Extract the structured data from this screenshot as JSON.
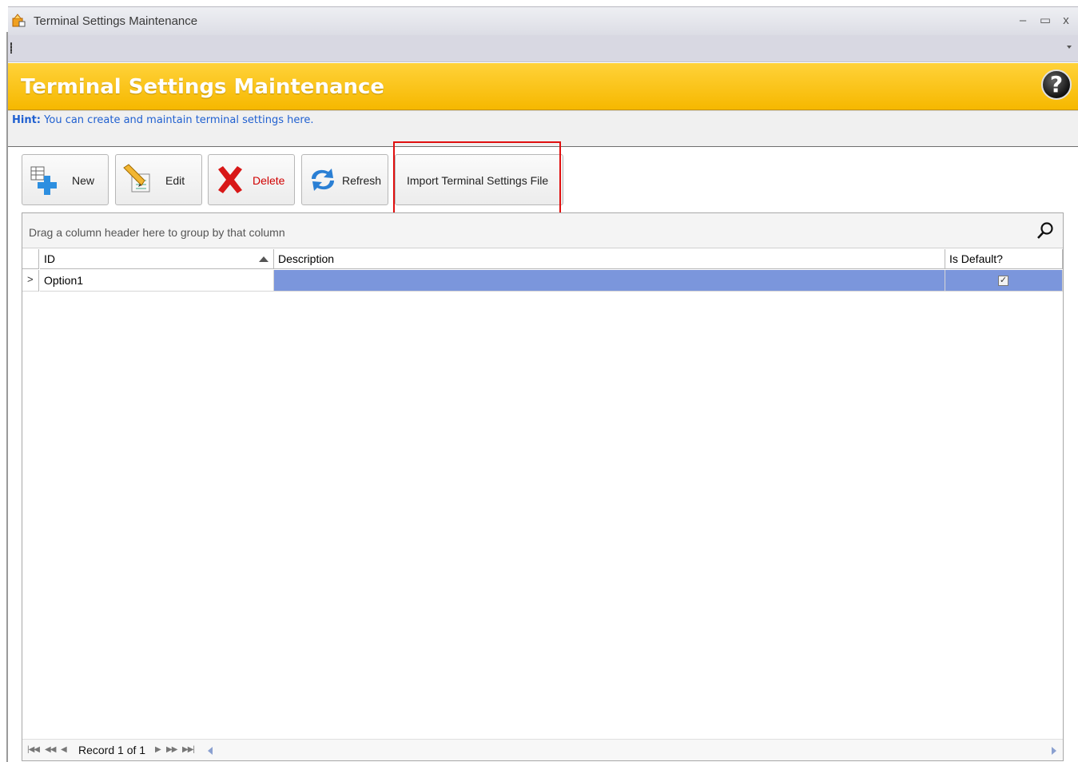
{
  "window": {
    "title": "Terminal Settings Maintenance",
    "controls": {
      "minimize": "–",
      "maximize": "▭",
      "close": "x"
    }
  },
  "banner": {
    "heading": "Terminal Settings Maintenance",
    "help_glyph": "?"
  },
  "hint": {
    "label": "Hint:",
    "text": " You can create and maintain terminal settings here."
  },
  "toolbar": {
    "new_label": "New",
    "edit_label": "Edit",
    "delete_label": "Delete",
    "refresh_label": "Refresh",
    "import_label": "Import Terminal Settings File"
  },
  "grid": {
    "group_panel_text": "Drag a column header here to group by that column",
    "columns": [
      {
        "label": "ID",
        "sorted": "ascending"
      },
      {
        "label": "Description"
      },
      {
        "label": "Is Default?"
      }
    ],
    "rows": [
      {
        "id": "Option1",
        "description": "",
        "is_default": true,
        "selected": true
      }
    ],
    "row_indicator": ">",
    "check_glyph": "✓",
    "selection_color": "#7b96dc"
  },
  "navigator": {
    "first": "|◀◀",
    "prev_page": "◀◀",
    "prev": "◀",
    "record_text": "Record 1 of 1",
    "next": "▶",
    "next_page": "▶▶",
    "last": "▶▶|"
  },
  "colors": {
    "banner": "#f6b800",
    "hint_text": "#2060d0",
    "highlight": "#e01010",
    "delete_text": "#d00000"
  }
}
